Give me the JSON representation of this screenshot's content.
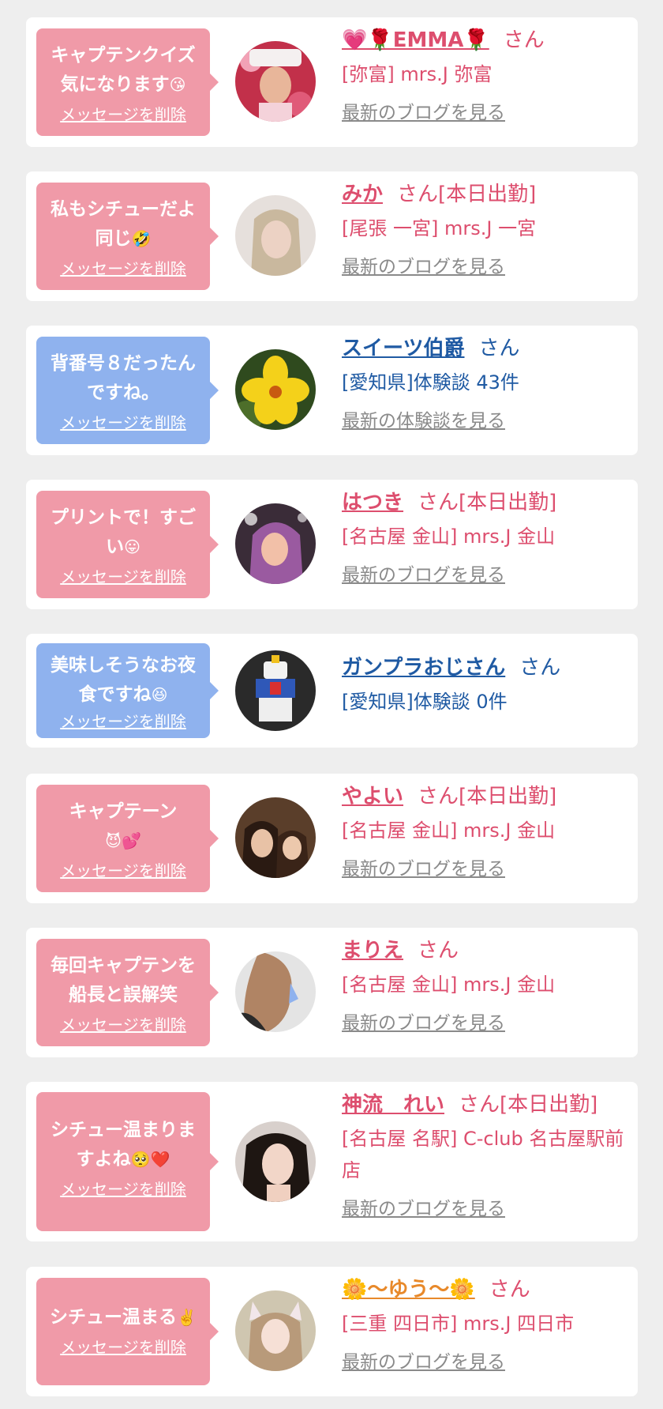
{
  "delete_label": "メッセージを削除",
  "colors": {
    "pink_bubble": "#f09aa8",
    "blue_bubble": "#8fb2ee",
    "pink_text": "#dd4e6e",
    "blue_text": "#1f5aa3",
    "link_gray": "#8a8a8a",
    "card_bg": "#ffffff",
    "page_bg": "#eeeeee"
  },
  "items": [
    {
      "kind": "cast",
      "message": "キャプテンクイズ\n気になります",
      "emoji": "😘",
      "name": "💗🌹EMMA🌹",
      "suffix": "さん",
      "shop": "[弥富] mrs.J 弥富",
      "link": "最新のブログを見る",
      "avatar": "avatar-emma-icon"
    },
    {
      "kind": "cast",
      "message": "私もシチューだよ\n同じ",
      "emoji": "🤣",
      "name": "みか",
      "suffix": "さん[本日出勤]",
      "shop": "[尾張 一宮] mrs.J 一宮",
      "link": "最新のブログを見る",
      "avatar": "avatar-mika-icon"
    },
    {
      "kind": "user",
      "message": "背番号８だったん\nですね。",
      "emoji": "",
      "name": "スイーツ伯爵",
      "suffix": "さん",
      "shop": "[愛知県]体験談 43件",
      "link": "最新の体験談を見る",
      "avatar": "avatar-yellow-flower-icon"
    },
    {
      "kind": "cast",
      "message": "プリントで！すご\nい",
      "emoji": "😛",
      "name": "はつき",
      "suffix": "さん[本日出勤]",
      "shop": "[名古屋 金山] mrs.J 金山",
      "link": "最新のブログを見る",
      "avatar": "avatar-hatsuki-icon"
    },
    {
      "kind": "user",
      "message": "美味しそうなお夜\n食ですね",
      "emoji": "😆",
      "name": "ガンプラおじさん",
      "suffix": "さん",
      "shop": "[愛知県]体験談 0件",
      "link": "",
      "avatar": "avatar-gundam-icon"
    },
    {
      "kind": "cast",
      "message": "キャプテーン\n",
      "emoji": "😈💕",
      "name": "やよい",
      "suffix": "さん[本日出勤]",
      "shop": "[名古屋 金山] mrs.J 金山",
      "link": "最新のブログを見る",
      "avatar": "avatar-yayoi-icon"
    },
    {
      "kind": "cast",
      "message": "毎回キャプテンを\n船長と誤解笑",
      "emoji": "",
      "name": "まりえ",
      "suffix": "さん",
      "shop": "[名古屋 金山] mrs.J 金山",
      "link": "最新のブログを見る",
      "avatar": "avatar-marie-icon"
    },
    {
      "kind": "cast",
      "message": "シチュー温まりま\nすよね",
      "emoji": "🥺❤️",
      "name": "神流　れい",
      "suffix": "さん[本日出勤]",
      "shop": "[名古屋 名駅] C-club 名古屋駅前店",
      "link": "最新のブログを見る",
      "avatar": "avatar-rei-icon"
    },
    {
      "kind": "cast",
      "message": "シチュー温まる",
      "emoji": "✌️",
      "name": "🌼〜ゆう〜🌼",
      "suffix": "さん",
      "shop": "[三重 四日市] mrs.J 四日市",
      "link": "最新のブログを見る",
      "avatar": "avatar-yuu-icon"
    }
  ]
}
